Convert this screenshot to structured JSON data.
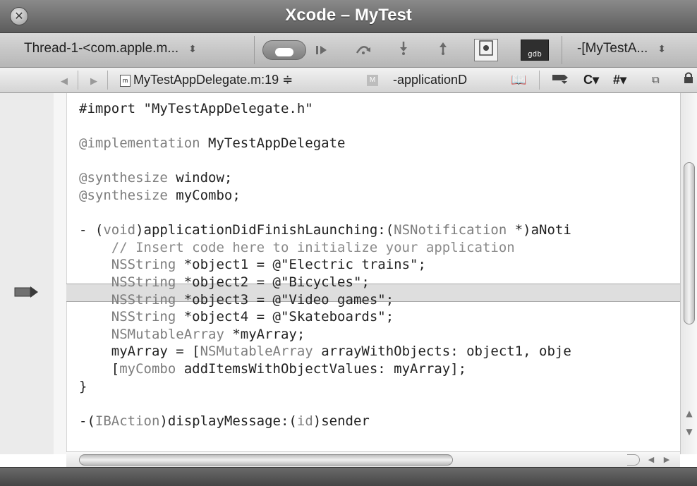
{
  "window": {
    "title": "Xcode – MyTest",
    "close_symbol": "✕"
  },
  "toolbar": {
    "thread_popup": "Thread-1-<com.apple.m...",
    "stack_popup": "-[MyTestA...",
    "stepper_symbol": "⬍",
    "icons": {
      "continue": "continue-icon",
      "pause": "pause-continue-icon",
      "step_over": "step-over-icon",
      "step_into": "step-into-icon",
      "step_out": "step-out-icon",
      "breakpoints": "breakpoints-icon",
      "gdb": "gdb"
    }
  },
  "navbar": {
    "back": "◀",
    "forward": "▶",
    "file": "MyTestAppDelegate.m:19 ≑",
    "method_badge": "M",
    "method": "-applicationD",
    "bookmarks_symbol": "📖",
    "class_menu": "C▾",
    "include_menu": "#▾",
    "counterparts_symbol": "⧉"
  },
  "editor": {
    "current_line_index": 10,
    "lines": [
      {
        "segments": [
          {
            "t": "#import \"MyTestAppDelegate.h\"",
            "c": ""
          }
        ]
      },
      {
        "segments": [
          {
            "t": "",
            "c": ""
          }
        ]
      },
      {
        "segments": [
          {
            "t": "@implementation",
            "c": "kw"
          },
          {
            "t": " MyTestAppDelegate",
            "c": ""
          }
        ]
      },
      {
        "segments": [
          {
            "t": "",
            "c": ""
          }
        ]
      },
      {
        "segments": [
          {
            "t": "@synthesize",
            "c": "kw"
          },
          {
            "t": " window;",
            "c": ""
          }
        ]
      },
      {
        "segments": [
          {
            "t": "@synthesize",
            "c": "kw"
          },
          {
            "t": " myCombo;",
            "c": ""
          }
        ]
      },
      {
        "segments": [
          {
            "t": "",
            "c": ""
          }
        ]
      },
      {
        "segments": [
          {
            "t": "- (",
            "c": ""
          },
          {
            "t": "void",
            "c": "kw"
          },
          {
            "t": ")applicationDidFinishLaunching:(",
            "c": ""
          },
          {
            "t": "NSNotification",
            "c": "kw"
          },
          {
            "t": " *)aNoti",
            "c": ""
          }
        ]
      },
      {
        "segments": [
          {
            "t": "    // Insert code here to initialize your application",
            "c": "cm"
          }
        ]
      },
      {
        "segments": [
          {
            "t": "    ",
            "c": ""
          },
          {
            "t": "NSString",
            "c": "kw"
          },
          {
            "t": " *object1 = @\"Electric trains\";",
            "c": ""
          }
        ]
      },
      {
        "segments": [
          {
            "t": "    ",
            "c": ""
          },
          {
            "t": "NSString",
            "c": "kw"
          },
          {
            "t": " *object2 = @\"Bicycles\";",
            "c": ""
          }
        ]
      },
      {
        "segments": [
          {
            "t": "    ",
            "c": ""
          },
          {
            "t": "NSString",
            "c": "kw"
          },
          {
            "t": " *object3 = @\"Video games\";",
            "c": ""
          }
        ]
      },
      {
        "segments": [
          {
            "t": "    ",
            "c": ""
          },
          {
            "t": "NSString",
            "c": "kw"
          },
          {
            "t": " *object4 = @\"Skateboards\";",
            "c": ""
          }
        ]
      },
      {
        "segments": [
          {
            "t": "    ",
            "c": ""
          },
          {
            "t": "NSMutableArray",
            "c": "kw"
          },
          {
            "t": " *myArray;",
            "c": ""
          }
        ]
      },
      {
        "segments": [
          {
            "t": "    myArray = [",
            "c": ""
          },
          {
            "t": "NSMutableArray",
            "c": "kw"
          },
          {
            "t": " arrayWithObjects: object1, obje",
            "c": ""
          }
        ]
      },
      {
        "segments": [
          {
            "t": "    [",
            "c": ""
          },
          {
            "t": "myCombo",
            "c": "kw"
          },
          {
            "t": " addItemsWithObjectValues: myArray];",
            "c": ""
          }
        ]
      },
      {
        "segments": [
          {
            "t": "}",
            "c": ""
          }
        ]
      },
      {
        "segments": [
          {
            "t": "",
            "c": ""
          }
        ]
      },
      {
        "segments": [
          {
            "t": "-(",
            "c": ""
          },
          {
            "t": "IBAction",
            "c": "kw"
          },
          {
            "t": ")displayMessage:(",
            "c": ""
          },
          {
            "t": "id",
            "c": "kw"
          },
          {
            "t": ")sender",
            "c": ""
          }
        ]
      }
    ]
  },
  "scrollbars": {
    "up": "▲",
    "down": "▼",
    "left": "◀",
    "right": "▶"
  }
}
